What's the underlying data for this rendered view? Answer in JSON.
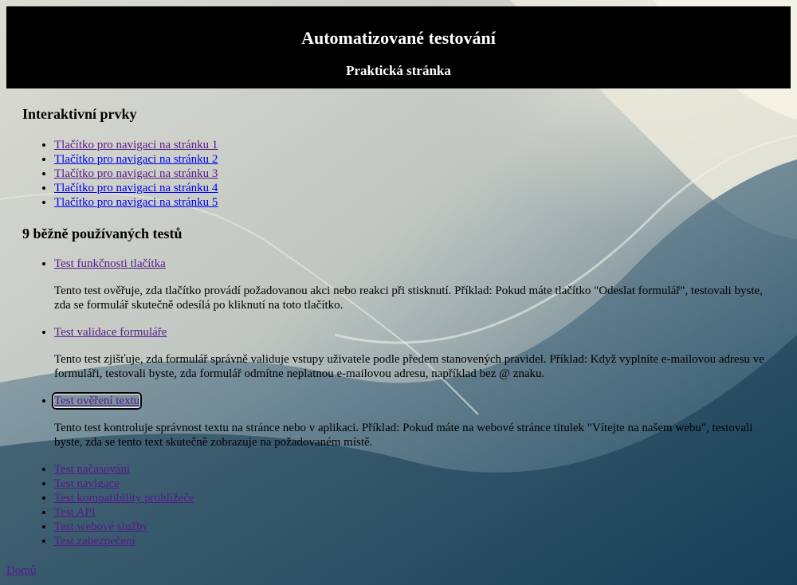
{
  "header": {
    "title": "Automatizované testování",
    "subtitle": "Praktická stránka"
  },
  "interactive": {
    "heading": "Interaktivní prvky",
    "links": [
      {
        "label": "Tlačítko pro navigaci na stránku 1"
      },
      {
        "label": "Tlačítko pro navigaci na stránku 2"
      },
      {
        "label": "Tlačítko pro navigaci na stránku 3"
      },
      {
        "label": "Tlačítko pro navigaci na stránku 4"
      },
      {
        "label": "Tlačítko pro navigaci na stránku 5"
      }
    ]
  },
  "tests": {
    "heading": "9 běžně používaných testů",
    "detailed": [
      {
        "label": "Test funkčnosti tlačítka",
        "description": "Tento test ověřuje, zda tlačítko provádí požadovanou akci nebo reakci při stisknutí. Příklad: Pokud máte tlačítko \"Odeslat formulář\", testovali byste, zda se formulář skutečně odesílá po kliknutí na toto tlačítko."
      },
      {
        "label": "Test validace formuláře",
        "description": "Tento test zjišťuje, zda formulář správně validuje vstupy uživatele podle předem stanovených pravidel. Příklad: Když vyplníte e-mailovou adresu ve formuláři, testovali byste, zda formulář odmítne neplatnou e-mailovou adresu, například bez @ znaku."
      },
      {
        "label": "Test ověření textu",
        "description": "Tento test kontroluje správnost textu na stránce nebo v aplikaci. Příklad: Pokud máte na webové stránce titulek \"Vítejte na našem webu\", testovali byste, zda se tento text skutečně zobrazuje na požadovaném místě."
      }
    ],
    "others": [
      {
        "label": "Test načasování"
      },
      {
        "label": "Test navigace"
      },
      {
        "label": "Test kompatibility prohlížeče"
      },
      {
        "label": "Test API"
      },
      {
        "label": "Test webové služby"
      },
      {
        "label": "Test zabezpečení"
      }
    ]
  },
  "footer": {
    "back_label": "Domů"
  },
  "colors": {
    "header_bg": "#000000",
    "visited_link": "#551a8b",
    "unvisited_link": "#0000ee"
  }
}
